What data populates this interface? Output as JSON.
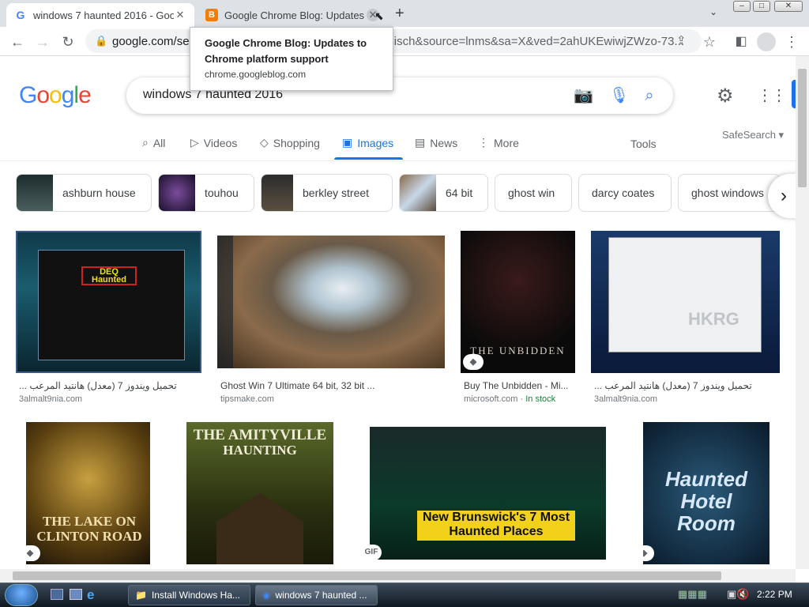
{
  "tabs": [
    {
      "title": "windows 7 haunted 2016 - Google",
      "close": "✕"
    },
    {
      "title": "Google Chrome Blog: Updates to",
      "close": "✕"
    }
  ],
  "new_tab": "+",
  "toolbar": {
    "url_visible": "google.com/sea",
    "url_tail": "=isch&source=lnms&sa=X&ved=2ahUKEwiwjZWzo-73..."
  },
  "tooltip": {
    "title": "Google Chrome Blog: Updates to Chrome platform support",
    "domain": "chrome.googleblog.com"
  },
  "search": {
    "query": "windows 7 haunted 2016"
  },
  "nav": {
    "items": [
      {
        "label": "All",
        "icon": "search-icon"
      },
      {
        "label": "Videos",
        "icon": "play-icon"
      },
      {
        "label": "Shopping",
        "icon": "tag-icon"
      },
      {
        "label": "Images",
        "icon": "image-icon"
      },
      {
        "label": "News",
        "icon": "news-icon"
      },
      {
        "label": "More",
        "icon": "more-vert-icon"
      }
    ],
    "tools": "Tools",
    "safesearch": "SafeSearch"
  },
  "chips": [
    "ashburn house",
    "touhou",
    "berkley street",
    "64 bit",
    "ghost win",
    "darcy coates",
    "ghost windows"
  ],
  "results": [
    {
      "caption": "تحميل ويندوز 7 (معدل) هانتيد المرعب ...",
      "source": "3almalt9nia.com"
    },
    {
      "caption": "Ghost Win 7 Ultimate 64 bit, 32 bit ...",
      "source": "tipsmake.com"
    },
    {
      "caption": "Buy The Unbidden - Mi...",
      "source": "microsoft.com",
      "stock": "In stock"
    },
    {
      "caption": "تحميل ويندوز 7 (معدل) هانتيد المرعب ...",
      "source": "3almalt9nia.com"
    }
  ],
  "poster_text": {
    "unbidden": "THE UNBIDDEN",
    "hkrg": "HKRG",
    "lake": "THE LAKE ON CLINTON ROAD",
    "amity_1": "THE AMITYVILLE",
    "amity_2": "HAUNTING",
    "brunswick": "New Brunswick's 7 Most Haunted Places",
    "hotel": "Haunted Hotel Room",
    "gif": "GIF"
  },
  "taskbar": {
    "items": [
      "Install Windows Ha...",
      "windows 7 haunted ..."
    ],
    "clock": "2:22 PM"
  },
  "colors": {
    "accent": "#1a73e8",
    "stock": "#188038"
  }
}
